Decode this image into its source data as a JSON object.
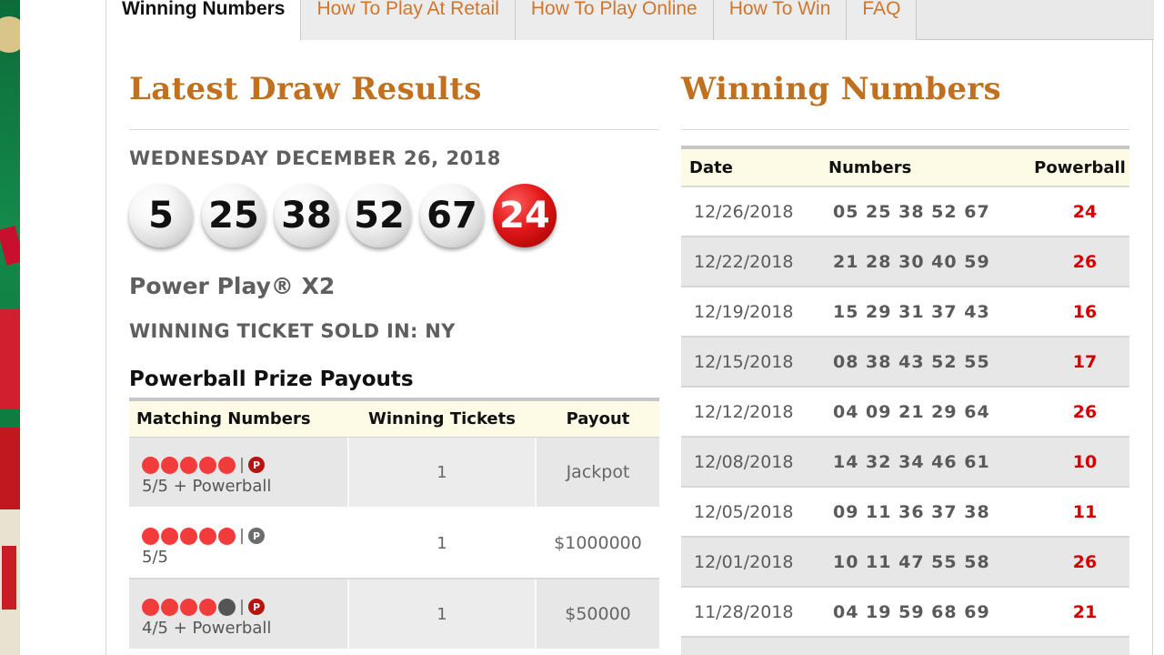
{
  "tabs": [
    {
      "label": "Winning Numbers",
      "active": true
    },
    {
      "label": "How To Play At Retail",
      "active": false
    },
    {
      "label": "How To Play Online",
      "active": false
    },
    {
      "label": "How To Win",
      "active": false
    },
    {
      "label": "FAQ",
      "active": false
    }
  ],
  "latest": {
    "title": "Latest Draw Results",
    "date": "WEDNESDAY DECEMBER 26, 2018",
    "balls": [
      "5",
      "25",
      "38",
      "52",
      "67"
    ],
    "powerball": "24",
    "power_play": "Power Play® X2",
    "ticket_sold": "WINNING TICKET SOLD IN: NY",
    "payouts_title": "Powerball Prize Payouts"
  },
  "payouts": {
    "headers": [
      "Matching Numbers",
      "Winning Tickets",
      "Payout"
    ],
    "rows": [
      {
        "label": "5/5 + Powerball",
        "tickets": "1",
        "payout": "Jackpot"
      },
      {
        "label": "5/5",
        "tickets": "1",
        "payout": "$1000000"
      },
      {
        "label": "4/5 + Powerball",
        "tickets": "1",
        "payout": "$50000"
      }
    ],
    "powerball_icon_letter": "P"
  },
  "winning": {
    "title": "Winning Numbers",
    "headers": [
      "Date",
      "Numbers",
      "Powerball"
    ],
    "rows": [
      {
        "date": "12/26/2018",
        "numbers": "05 25 38 52 67",
        "pb": "24"
      },
      {
        "date": "12/22/2018",
        "numbers": "21 28 30 40 59",
        "pb": "26"
      },
      {
        "date": "12/19/2018",
        "numbers": "15 29 31 37 43",
        "pb": "16"
      },
      {
        "date": "12/15/2018",
        "numbers": "08 38 43 52 55",
        "pb": "17"
      },
      {
        "date": "12/12/2018",
        "numbers": "04 09 21 29 64",
        "pb": "26"
      },
      {
        "date": "12/08/2018",
        "numbers": "14 32 34 46 61",
        "pb": "10"
      },
      {
        "date": "12/05/2018",
        "numbers": "09 11 36 37 38",
        "pb": "11"
      },
      {
        "date": "12/01/2018",
        "numbers": "10 11 47 55 58",
        "pb": "26"
      },
      {
        "date": "11/28/2018",
        "numbers": "04 19 59 68 69",
        "pb": "21"
      }
    ]
  },
  "colors": {
    "accent": "#c0701e",
    "tab_link": "#d0762c",
    "powerball_red": "#d40000",
    "header_bg": "#fdfbe6"
  }
}
